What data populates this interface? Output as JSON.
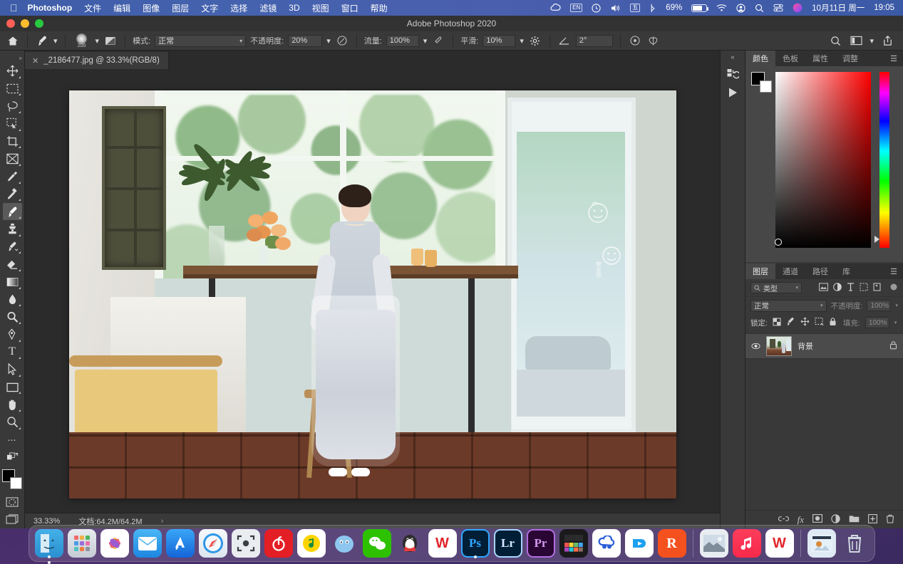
{
  "menubar": {
    "apple_icon": "apple-icon",
    "app_name": "Photoshop",
    "items": [
      "文件",
      "编辑",
      "图像",
      "图层",
      "文字",
      "选择",
      "滤镜",
      "3D",
      "视图",
      "窗口",
      "帮助"
    ],
    "status": {
      "creative_cloud_icon": "creative-cloud-icon",
      "input_source": "EN",
      "time_machine_icon": "clock-icon",
      "volume_icon": "speaker-icon",
      "ime_icon": "五",
      "bluetooth_icon": "bluetooth-icon",
      "battery_percent": "69%",
      "wifi_icon": "wifi-icon",
      "user_icon": "account-icon",
      "search_icon": "search-icon",
      "control_center_icon": "control-center-icon",
      "siri_icon": "siri-icon",
      "date": "10月11日 周一",
      "time": "19:05"
    }
  },
  "titlebar": {
    "title": "Adobe Photoshop 2020"
  },
  "options": {
    "home_icon": "home-icon",
    "tool_icon": "brush-icon",
    "brush_size": "200",
    "brush_panel_icon": "brush-settings-icon",
    "mode_label": "模式:",
    "mode_value": "正常",
    "opacity_label": "不透明度:",
    "opacity_value": "20%",
    "pressure_opacity_icon": "pressure-opacity-icon",
    "flow_label": "流量:",
    "flow_value": "100%",
    "airbrush_icon": "airbrush-icon",
    "smoothing_label": "平滑:",
    "smoothing_value": "10%",
    "smoothing_gear_icon": "gear-icon",
    "angle_icon": "angle-icon",
    "angle_value": "2°",
    "pressure_size_icon": "pressure-size-icon",
    "symmetry_icon": "symmetry-icon",
    "search_icon": "search-icon",
    "workspace_icon": "workspace-icon",
    "workspace_chevron": "chevron-down-icon",
    "share_icon": "share-icon"
  },
  "tools": {
    "expand_icon": "expand-panel-icon",
    "items": [
      {
        "name": "move-tool",
        "glyph": "✥"
      },
      {
        "name": "marquee-tool",
        "glyph": "▢"
      },
      {
        "name": "lasso-tool",
        "glyph": "◯"
      },
      {
        "name": "quick-selection-tool",
        "glyph": "▣"
      },
      {
        "name": "crop-tool",
        "glyph": "⌗"
      },
      {
        "name": "frame-tool",
        "glyph": "⊠"
      },
      {
        "name": "eyedropper-tool",
        "glyph": "⌁"
      },
      {
        "name": "spot-healing-tool",
        "glyph": "✎"
      },
      {
        "name": "brush-tool",
        "glyph": "✒",
        "active": true
      },
      {
        "name": "clone-stamp-tool",
        "glyph": "⎙"
      },
      {
        "name": "history-brush-tool",
        "glyph": "✧"
      },
      {
        "name": "eraser-tool",
        "glyph": "◣"
      },
      {
        "name": "gradient-tool",
        "glyph": "▤"
      },
      {
        "name": "blur-tool",
        "glyph": "💧"
      },
      {
        "name": "dodge-tool",
        "glyph": "🔍"
      },
      {
        "name": "pen-tool",
        "glyph": "✐"
      },
      {
        "name": "type-tool",
        "glyph": "T"
      },
      {
        "name": "path-selection-tool",
        "glyph": "⬈"
      },
      {
        "name": "rectangle-tool",
        "glyph": "▭"
      },
      {
        "name": "hand-tool",
        "glyph": "✋"
      },
      {
        "name": "zoom-tool",
        "glyph": "⌕"
      },
      {
        "name": "edit-toolbar-more",
        "glyph": "•••"
      },
      {
        "name": "default-colors-icon",
        "glyph": "⧉"
      }
    ],
    "foreground_color": "#000000",
    "background_color": "#ffffff",
    "quick_mask_icon": "quick-mask-icon",
    "screen_mode_icon": "screen-mode-icon"
  },
  "document": {
    "tab_title": "_2186477.jpg @ 33.3%(RGB/8)",
    "close_icon": "close-icon"
  },
  "status": {
    "zoom": "33.33%",
    "doc_info": "文档:64.2M/64.2M",
    "arrow_icon": "chevron-right-icon"
  },
  "rail": {
    "collapse_icon": "collapse-panels-icon",
    "history_icon": "history-icon",
    "actions_play_icon": "play-icon"
  },
  "color_panel": {
    "tabs": [
      "颜色",
      "色板",
      "属性",
      "调整"
    ],
    "active_tab": "颜色",
    "menu_icon": "panel-menu-icon",
    "foreground_color": "#000000",
    "background_color": "#ffffff",
    "spectrum_base_hue": "#ff0000"
  },
  "layers_panel": {
    "tabs": [
      "图层",
      "通道",
      "路径",
      "库"
    ],
    "active_tab": "图层",
    "menu_icon": "panel-menu-icon",
    "filter_placeholder": "类型",
    "filter_search_icon": "search-icon",
    "filter_icons": [
      "pixel-filter-icon",
      "adjustment-filter-icon",
      "type-filter-icon",
      "shape-filter-icon",
      "smart-object-filter-icon"
    ],
    "filter_toggle_icon": "filter-toggle-icon",
    "blend_mode": "正常",
    "opacity_label": "不透明度:",
    "opacity_value": "100%",
    "lock_label": "锁定:",
    "lock_icons": [
      "lock-transparent-icon",
      "lock-image-icon",
      "lock-position-icon",
      "lock-artboard-icon",
      "lock-all-icon"
    ],
    "fill_label": "填充:",
    "fill_value": "100%",
    "layers": [
      {
        "name": "背景",
        "visible": true,
        "locked": true,
        "eye_icon": "eye-icon",
        "lock_icon": "lock-icon"
      }
    ],
    "footer_icons": [
      "link-layers-icon",
      "layer-style-fx-icon",
      "add-mask-icon",
      "new-adjustment-layer-icon",
      "new-group-icon",
      "new-layer-icon",
      "delete-layer-icon"
    ]
  },
  "dock": {
    "items": [
      {
        "name": "finder",
        "label": "",
        "color": "#3aa5e8",
        "glyph": "🙂",
        "running": true
      },
      {
        "name": "launchpad",
        "label": "",
        "color": "#c9cdd4",
        "glyph": "⠿",
        "running": false
      },
      {
        "name": "photos",
        "label": "",
        "color": "#ffffff",
        "glyph": "❀",
        "running": false
      },
      {
        "name": "mail",
        "label": "",
        "color": "#2f9bed",
        "glyph": "✉",
        "running": false
      },
      {
        "name": "app-store",
        "label": "",
        "color": "#2b84f2",
        "glyph": "A",
        "running": false
      },
      {
        "name": "safari",
        "label": "",
        "color": "#f2f6fb",
        "glyph": "🧭",
        "running": false
      },
      {
        "name": "screenshot",
        "label": "",
        "color": "#f0f0f0",
        "glyph": "⎙",
        "running": false
      },
      {
        "name": "netease-music",
        "label": "",
        "color": "#e02020",
        "glyph": "◎",
        "running": false
      },
      {
        "name": "qq-music",
        "label": "",
        "color": "#ffffff",
        "glyph": "♪",
        "running": false
      },
      {
        "name": "bilibili",
        "label": "",
        "color": "#8ec3ef",
        "glyph": "◠",
        "running": false
      },
      {
        "name": "wechat",
        "label": "",
        "color": "#2dc100",
        "glyph": "💬",
        "running": false
      },
      {
        "name": "qq",
        "label": "",
        "color": "#ffffff",
        "glyph": "🐧",
        "running": false
      },
      {
        "name": "wps-office",
        "label": "",
        "color": "#ffffff",
        "glyph": "W",
        "running": false
      },
      {
        "name": "photoshop",
        "label": "Ps",
        "color": "#001e36",
        "glyph": "Ps",
        "running": true
      },
      {
        "name": "lightroom",
        "label": "Lr",
        "color": "#001e36",
        "glyph": "Lr",
        "running": false
      },
      {
        "name": "premiere-pro",
        "label": "Pr",
        "color": "#2a0634",
        "glyph": "Pr",
        "running": false
      },
      {
        "name": "final-cut-pro",
        "label": "",
        "color": "#1c1c1e",
        "glyph": "🎬",
        "running": false
      },
      {
        "name": "baidu-netdisk",
        "label": "",
        "color": "#ffffff",
        "glyph": "☁",
        "running": false
      },
      {
        "name": "youku",
        "label": "",
        "color": "#ffffff",
        "glyph": "▶",
        "running": false
      },
      {
        "name": "renren-video",
        "label": "R",
        "color": "#f4511e",
        "glyph": "R",
        "running": false
      },
      {
        "name": "separator-1",
        "label": "",
        "color": "",
        "glyph": "",
        "running": false
      },
      {
        "name": "photos-folder",
        "label": "",
        "color": "#cfd6dd",
        "glyph": "🏞",
        "running": false
      },
      {
        "name": "music",
        "label": "",
        "color": "#fa2d48",
        "glyph": "♫",
        "running": false
      },
      {
        "name": "wps-writer",
        "label": "",
        "color": "#ffffff",
        "glyph": "W",
        "running": false
      },
      {
        "name": "separator-2",
        "label": "",
        "color": "",
        "glyph": "",
        "running": false
      },
      {
        "name": "downloads-stack",
        "label": "",
        "color": "#dce6f2",
        "glyph": "🗂",
        "running": false
      },
      {
        "name": "trash",
        "label": "",
        "color": "#b9c3cc",
        "glyph": "🗑",
        "running": false
      }
    ]
  }
}
